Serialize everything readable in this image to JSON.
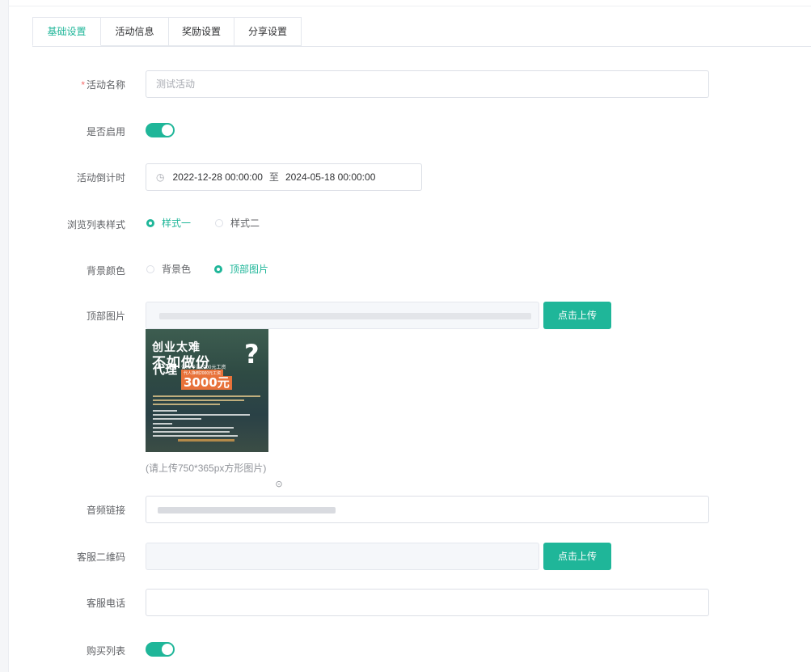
{
  "tabs": [
    {
      "label": "基础设置",
      "active": true
    },
    {
      "label": "活动信息",
      "active": false
    },
    {
      "label": "奖励设置",
      "active": false
    },
    {
      "label": "分享设置",
      "active": false
    }
  ],
  "form": {
    "activity_name": {
      "label": "活动名称",
      "required_mark": "*",
      "value": "测试活动"
    },
    "enabled": {
      "label": "是否启用",
      "on": true
    },
    "countdown": {
      "label": "活动倒计时",
      "clock_icon": "clock-icon",
      "start": "2022-12-28 00:00:00",
      "separator": "至",
      "end": "2024-05-18 00:00:00"
    },
    "list_style": {
      "label": "浏览列表样式",
      "options": [
        "样式一",
        "样式二"
      ],
      "selected": "样式一"
    },
    "background": {
      "label": "背景颜色",
      "options": [
        "背景色",
        "顶部图片"
      ],
      "selected": "顶部图片"
    },
    "top_image": {
      "label": "顶部图片",
      "upload_label": "点击上传",
      "hint": "(请上传750*365px方形图片)",
      "clear_icon": "close-circle-icon",
      "poster": {
        "line1": "创业太难",
        "line2": "不如做份",
        "question": "?",
        "line3": "代理",
        "small1": "告人辛苦2000元工资",
        "small2": "代人挣到2000元工资",
        "amount": "3000元"
      }
    },
    "audio_link": {
      "label": "音频链接"
    },
    "cs_qrcode": {
      "label": "客服二维码",
      "upload_label": "点击上传"
    },
    "cs_phone": {
      "label": "客服电话",
      "value": ""
    },
    "buy_list": {
      "label": "购买列表",
      "on": true
    }
  },
  "colors": {
    "accent": "#1fb699",
    "required": "#f56c6c"
  }
}
